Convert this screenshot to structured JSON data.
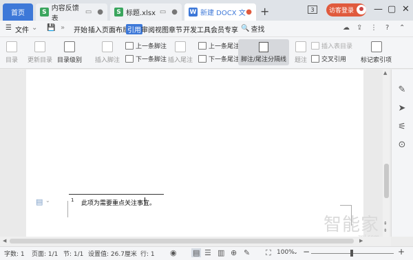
{
  "tabs": {
    "home": "首页",
    "items": [
      {
        "label": "内容反馈表",
        "icon": "S",
        "color": "#3aa55d"
      },
      {
        "label": "标题.xlsx",
        "icon": "S",
        "color": "#3aa55d"
      },
      {
        "label": "新建 DOCX 文",
        "icon": "W",
        "color": "#3d78d8"
      }
    ],
    "add": "+",
    "window_count": "3",
    "visitor_login": "访客登录"
  },
  "menubar": {
    "file": "文件",
    "items": [
      "开始",
      "插入",
      "页面布局",
      "引用",
      "审阅",
      "视图",
      "章节",
      "开发工具",
      "会员专享"
    ],
    "active": "引用",
    "search": "查找"
  },
  "ribbon": {
    "toc": "目录",
    "update_toc": "更新目录",
    "toc_level": "目录级别",
    "insert_footnote": "插入脚注",
    "prev_footnote": "上一条脚注",
    "next_footnote": "下一条脚注",
    "insert_endnote": "插入尾注",
    "prev_endnote": "上一条尾注",
    "next_endnote": "下一条尾注",
    "separator": "脚注/尾注分隔线",
    "caption": "题注",
    "insert_table_of_figures": "插入表目录",
    "cross_reference": "交叉引用",
    "mark_index": "标记索引项"
  },
  "document": {
    "text": "此项为需要重点关注事宜。",
    "footnote_num": "1"
  },
  "status": {
    "word_count": "字数: 1",
    "page": "页面: 1/1",
    "section": "节: 1/1",
    "setting": "设置值: 26.7厘米",
    "row": "行: 1",
    "zoom": "100%",
    "zoom_minus": "−",
    "zoom_plus": "+"
  },
  "watermark": {
    "brand": "智能家",
    "url": "znj.com"
  }
}
